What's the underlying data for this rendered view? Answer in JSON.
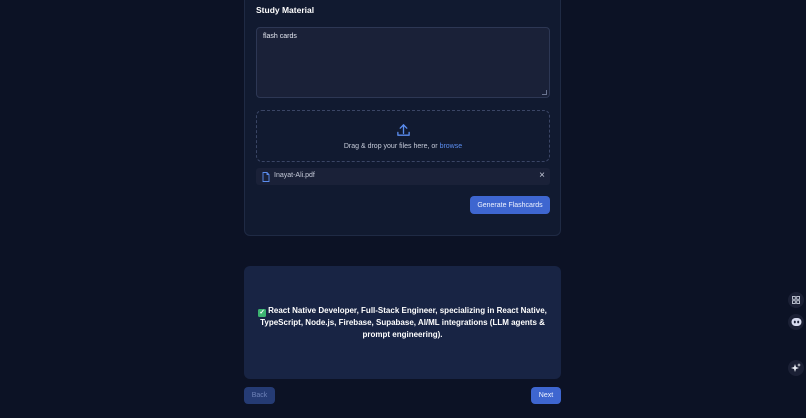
{
  "form": {
    "section_title": "Study Material",
    "textarea_value": "flash cards",
    "dropzone": {
      "text": "Drag & drop your files here, or ",
      "link": "browse",
      "icon": "upload-icon"
    },
    "file": {
      "name": "Inayat-Ali.pdf",
      "icon": "file-icon",
      "remove_icon": "close-icon"
    },
    "generate_label": "Generate Flashcards"
  },
  "flashcard": {
    "text": "React Native Developer, Full-Stack Engineer, specializing in React Native, TypeScript, Node.js, Firebase, Supabase, AI/ML integrations (LLM agents & prompt engineering).",
    "icon": "check-mark-emoji"
  },
  "nav": {
    "back_label": "Back",
    "next_label": "Next"
  },
  "side_tools": [
    "grid-icon",
    "bot-icon",
    "sparkle-icon"
  ],
  "colors": {
    "background": "#0c1225",
    "panel": "#111a30",
    "accent": "#3e66d0",
    "link": "#5b8def",
    "card": "#182444"
  }
}
